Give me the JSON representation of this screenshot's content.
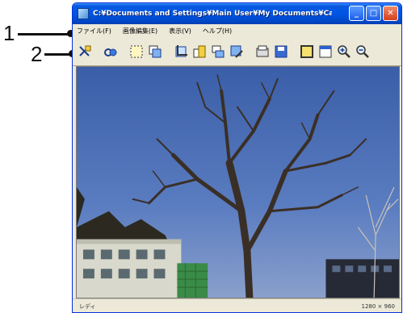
{
  "callouts": {
    "one": "1",
    "two": "2"
  },
  "window": {
    "title": "C:¥Documents and Settings¥Main User¥My Documents¥Capti...",
    "buttons": {
      "minimize": "_",
      "maximize": "□",
      "close": "✕"
    }
  },
  "menu": {
    "file": "ファイル(F)",
    "image_edit": "画像編集(E)",
    "view": "表示(V)",
    "help": "ヘルプ(H)"
  },
  "toolbar": {
    "icons": [
      "capture-icon",
      "link-icon",
      "select-icon",
      "copy-icon",
      "crop-icon",
      "resize-icon",
      "rotate-icon",
      "edit-icon",
      "print-icon",
      "save-icon",
      "fit-window-icon",
      "actual-size-icon",
      "zoom-in-icon",
      "zoom-out-icon"
    ]
  },
  "status": {
    "left": "レディ",
    "right": "1280 × 960"
  },
  "colors": {
    "title_bar": "#0055e5",
    "window_chrome": "#ece9d8",
    "sky": "#3f63ad"
  }
}
